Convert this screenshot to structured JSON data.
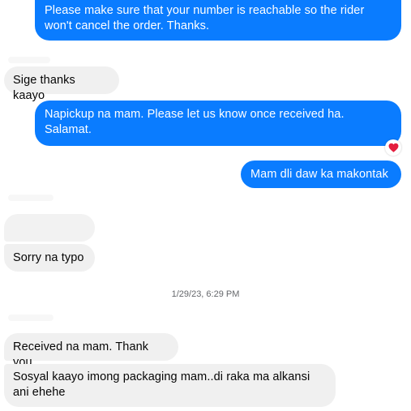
{
  "messages": {
    "m1": "Please make sure that your number is reachable so the rider\nwon't cancel the order. Thanks.",
    "m2": "Sige thanks kaayo",
    "m3": "Napickup na mam. Please let us know once received ha.\nSalamat.",
    "m4": "Mam dli daw ka makontak",
    "m6": "Sorry na typo",
    "m7": "Received na mam. Thank you",
    "m8": "Sosyal kaayo imong packaging mam..di raka ma alkansi\nani ehehe"
  },
  "timestamp": "1/29/23, 6:29 PM",
  "reaction": {
    "icon": "heart-icon",
    "color": "#e41e3f"
  },
  "colors": {
    "outgoing": "#0a7cff",
    "incoming": "#f0f0f0",
    "timestamp": "#65676b"
  }
}
